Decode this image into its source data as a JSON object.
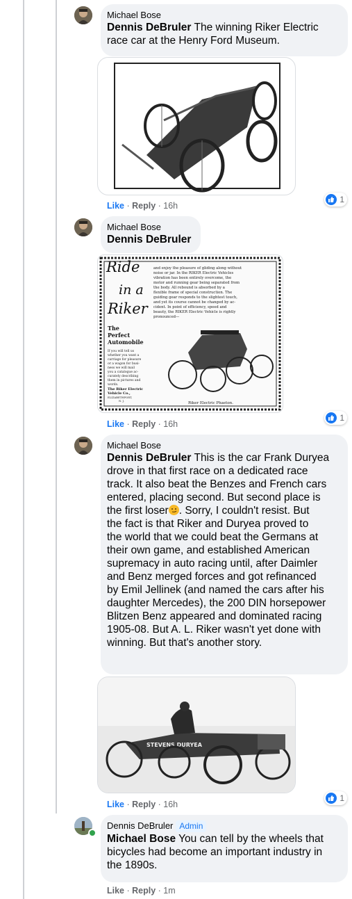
{
  "comments": [
    {
      "author": "Michael Bose",
      "mention": "Dennis DeBruler",
      "text_lines": [
        " The winning Riker Electric",
        "race car at the Henry Ford Museum."
      ],
      "actions": {
        "like": "Like",
        "reply": "Reply",
        "time": "16h"
      },
      "reactions": "1"
    },
    {
      "author": "Michael Bose",
      "mention": "Dennis DeBruler",
      "actions": {
        "like": "Like",
        "reply": "Reply",
        "time": "16h"
      },
      "reactions": "1",
      "ad": {
        "ride": "Ride",
        "in_a": "in a",
        "riker": "Riker",
        "perfect": [
          "The",
          "Perfect",
          "Automobile"
        ],
        "small": [
          "If you will tell us",
          "whether you want a",
          "carriage for pleasure",
          "or a wagon for busi-",
          "ness we will mail",
          "you a catalogue ac-",
          "curately describing",
          "them in pictures and",
          "words."
        ],
        "company": [
          "The Riker Electric",
          "Vehicle Co.,",
          "ELIZABETHPORT,",
          "N. J."
        ],
        "copy_lines": [
          "and enjoy the pleasure of gliding along without",
          "noise or jar.  In the RIKER Electric Vehicles",
          "vibration has been entirely overcome, the",
          "motor and running gear being separated from",
          "the body.  All rebound is absorbed by a",
          "flexible frame of special construction.  The",
          "guiding gear responds to the slightest touch,",
          "and yet its course cannot be changed by ac-",
          "cident.  In point of efficiency, speed and",
          "beauty, the RIKER Electric Vehicle is rightly",
          "pronounced—"
        ],
        "caption": "Riker Electric Phaeton."
      }
    },
    {
      "author": "Michael Bose",
      "mention": "Dennis DeBruler",
      "text_lines": [
        " This is the car Frank Duryea",
        "drove in that first race on a dedicated race",
        "track. It also beat the Benzes and French cars",
        "entered, placing second. But second place is",
        "the first loser",
        ". Sorry, I couldn't resist. But",
        "the fact is that Riker and Duryea proved to",
        "the world that we could beat the Germans at",
        "their own game, and established American",
        "supremacy in auto racing until, after Daimler",
        "and Benz merged forces and got refinanced",
        "by Emil Jellinek (and named the cars after his",
        "daughter Mercedes), the 200 DIN horsepower",
        "Blitzen Benz appeared and dominated racing",
        "1905-08. But A. L. Riker wasn't yet done with",
        "winning. But that's another story."
      ],
      "photo_text": "STEVENS DURYEA",
      "actions": {
        "like": "Like",
        "reply": "Reply",
        "time": "16h"
      },
      "reactions": "1"
    },
    {
      "author": "Dennis DeBruler",
      "badge": "Admin",
      "mention": "Michael Bose",
      "text_lines": [
        " You can tell by the wheels that",
        "bicycles had become an important industry in",
        "the 1890s."
      ],
      "actions": {
        "like": "Like",
        "reply": "Reply",
        "time": "1m"
      }
    }
  ]
}
